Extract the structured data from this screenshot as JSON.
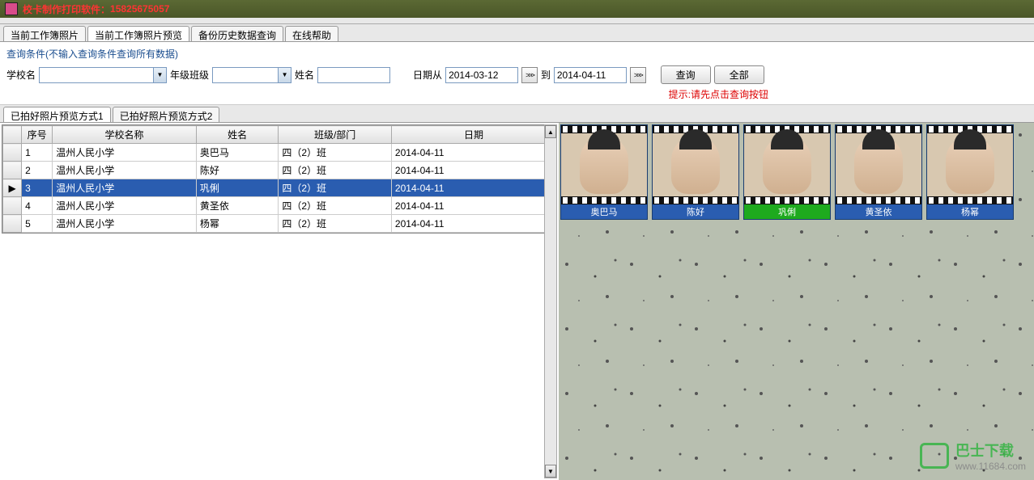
{
  "title_prefix": "校卡制作打印软件：",
  "title_phone": "15825675057",
  "main_tabs": [
    "当前工作簿照片",
    "当前工作簿照片预览",
    "备份历史数据查询",
    "在线帮助"
  ],
  "active_main_tab": 1,
  "search": {
    "hint": "查询条件(不输入查询条件查询所有数据)",
    "school_label": "学校名",
    "school_value": "",
    "class_label": "年级班级",
    "class_value": "",
    "name_label": "姓名",
    "name_value": "",
    "date_from_label": "日期从",
    "date_from": "2014-03-12",
    "date_to_label": "到",
    "date_to": "2014-04-11",
    "query_btn": "查询",
    "all_btn": "全部",
    "warn": "提示:请先点击查询按钮"
  },
  "sub_tabs": [
    "已拍好照片预览方式1",
    "已拍好照片预览方式2"
  ],
  "active_sub_tab": 0,
  "grid": {
    "headers": [
      "序号",
      "学校名称",
      "姓名",
      "班级/部门",
      "日期"
    ],
    "rows": [
      {
        "no": "1",
        "school": "温州人民小学",
        "name": "奥巴马",
        "class": "四（2）班",
        "date": "2014-04-11"
      },
      {
        "no": "2",
        "school": "温州人民小学",
        "name": "陈好",
        "class": "四（2）班",
        "date": "2014-04-11"
      },
      {
        "no": "3",
        "school": "温州人民小学",
        "name": "巩俐",
        "class": "四（2）班",
        "date": "2014-04-11"
      },
      {
        "no": "4",
        "school": "温州人民小学",
        "name": "黄圣依",
        "class": "四（2）班",
        "date": "2014-04-11"
      },
      {
        "no": "5",
        "school": "温州人民小学",
        "name": "杨幂",
        "class": "四（2）班",
        "date": "2014-04-11"
      }
    ],
    "selected_index": 2
  },
  "thumbnails": [
    {
      "label": "奥巴马"
    },
    {
      "label": "陈好"
    },
    {
      "label": "巩俐"
    },
    {
      "label": "黄圣依"
    },
    {
      "label": "杨幂"
    }
  ],
  "selected_thumb": 2,
  "watermark": {
    "name": "巴士下载",
    "url": "www.11684.com"
  }
}
